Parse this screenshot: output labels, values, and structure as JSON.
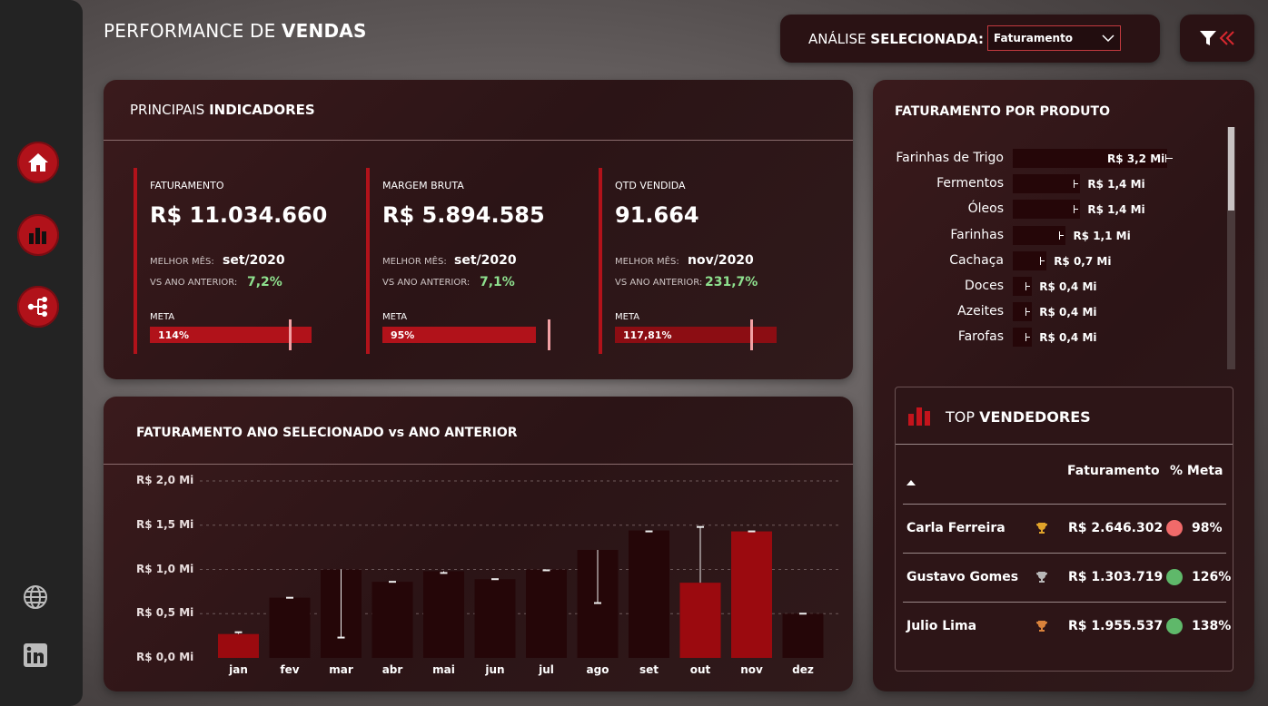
{
  "page_title": {
    "light": "PERFORMANCE DE ",
    "bold": "VENDAS"
  },
  "analysis": {
    "label_light": "ANÁLISE ",
    "label_bold": "SELECIONADA:",
    "selected": "Faturamento"
  },
  "indicators": {
    "title_light": "PRINCIPAIS ",
    "title_bold": "INDICADORES",
    "best_month_label": "MELHOR MÊS:",
    "vs_label": "VS ANO ANTERIOR:",
    "meta_label": "META",
    "items": [
      {
        "title": "FATURAMENTO",
        "value": "R$ 11.034.660",
        "best_month": "set/2020",
        "vs_prev": "7,2%",
        "meta_text": "114%",
        "meta_fill": 1.0,
        "meta_target": 0.87
      },
      {
        "title": "MARGEM BRUTA",
        "value": "R$ 5.894.585",
        "best_month": "set/2020",
        "vs_prev": "7,1%",
        "meta_text": "95%",
        "meta_fill": 0.95,
        "meta_target": 1.0
      },
      {
        "title": "QTD VENDIDA",
        "value": "91.664",
        "best_month": "nov/2020",
        "vs_prev": "231,7%",
        "meta_text": "117,81%",
        "meta_fill": 1.0,
        "meta_target": 0.85
      }
    ]
  },
  "products": {
    "title": "FATURAMENTO POR PRODUTO",
    "items": [
      {
        "name": "Farinhas de Trigo",
        "value": 3.2,
        "label": "R$ 3,2 Mi"
      },
      {
        "name": "Fermentos",
        "value": 1.4,
        "label": "R$ 1,4 Mi"
      },
      {
        "name": "Óleos",
        "value": 1.4,
        "label": "R$ 1,4 Mi"
      },
      {
        "name": "Farinhas",
        "value": 1.1,
        "label": "R$ 1,1 Mi"
      },
      {
        "name": "Cachaça",
        "value": 0.7,
        "label": "R$ 0,7 Mi"
      },
      {
        "name": "Doces",
        "value": 0.4,
        "label": "R$ 0,4 Mi"
      },
      {
        "name": "Azeites",
        "value": 0.4,
        "label": "R$ 0,4 Mi"
      },
      {
        "name": "Farofas",
        "value": 0.4,
        "label": "R$ 0,4 Mi"
      }
    ]
  },
  "vendors": {
    "title_light": "TOP ",
    "title_bold": "VENDEDORES",
    "col_fat": "Faturamento",
    "col_meta": "% Meta",
    "rows": [
      {
        "name": "Carla Ferreira",
        "fat": "R$ 2.646.302",
        "pct": "98%",
        "status_color": "#f06a6a",
        "trophy_color": "#e0a32a"
      },
      {
        "name": "Gustavo Gomes",
        "fat": "R$ 1.303.719",
        "pct": "126%",
        "status_color": "#5fb86a",
        "trophy_color": "#b8b8b8"
      },
      {
        "name": "Julio Lima",
        "fat": "R$ 1.955.537",
        "pct": "138%",
        "status_color": "#5fb86a",
        "trophy_color": "#d9823b"
      }
    ]
  },
  "colors": {
    "accent": "#b1121a",
    "bar_dark": "#250608",
    "bar_highlight": "#9b0a0f",
    "positive": "#8ee08e"
  },
  "chart_data": {
    "type": "bar",
    "title": "FATURAMENTO ANO SELECIONADO vs ANO ANTERIOR",
    "categories": [
      "jan",
      "fev",
      "mar",
      "abr",
      "mai",
      "jun",
      "jul",
      "ago",
      "set",
      "out",
      "nov",
      "dez"
    ],
    "values": [
      0.27,
      0.68,
      1.0,
      0.86,
      0.98,
      0.89,
      1.0,
      1.22,
      1.44,
      0.85,
      1.43,
      0.5
    ],
    "previous": [
      0.29,
      0.68,
      0.23,
      0.86,
      0.96,
      0.89,
      0.99,
      0.62,
      1.43,
      1.48,
      1.43,
      0.5
    ],
    "highlight": [
      true,
      false,
      false,
      false,
      false,
      false,
      false,
      false,
      false,
      true,
      true,
      false
    ],
    "yticks": [
      "R$ 0,0 Mi",
      "R$ 0,5 Mi",
      "R$ 1,0 Mi",
      "R$ 1,5 Mi",
      "R$ 2,0 Mi"
    ],
    "ylim": [
      0,
      2.0
    ],
    "grid": true
  }
}
